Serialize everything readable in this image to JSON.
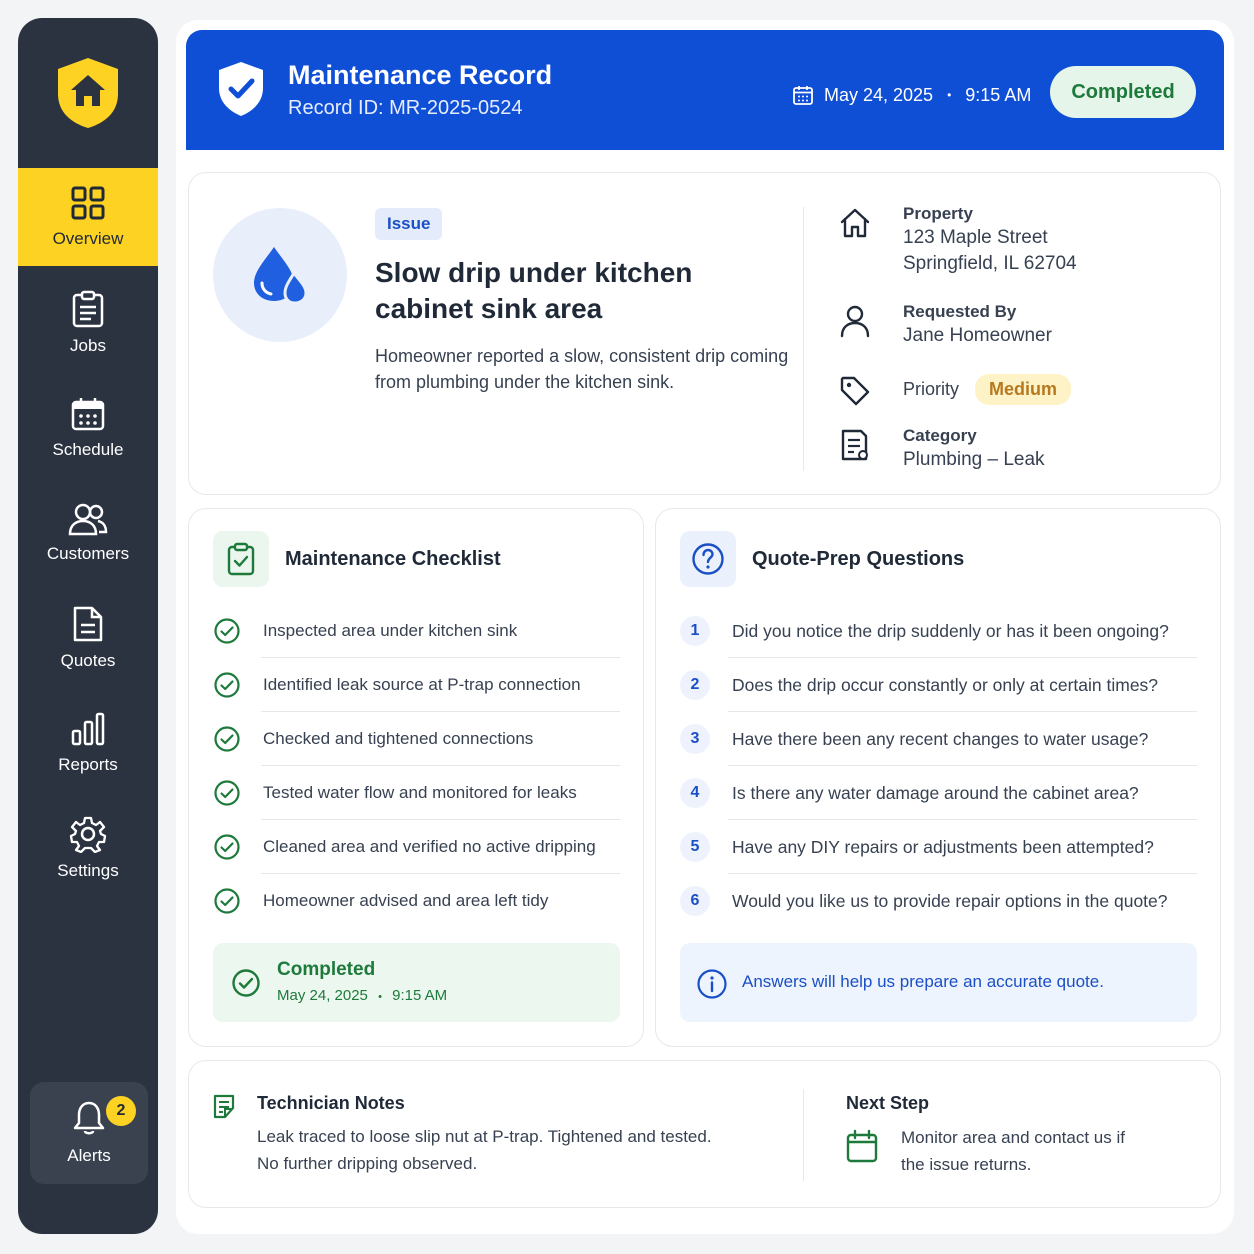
{
  "sidebar": {
    "items": [
      {
        "label": "Overview",
        "icon": "grid-icon",
        "active": true
      },
      {
        "label": "Jobs",
        "icon": "clipboard-icon"
      },
      {
        "label": "Schedule",
        "icon": "calendar-icon"
      },
      {
        "label": "Customers",
        "icon": "users-icon"
      },
      {
        "label": "Quotes",
        "icon": "document-icon"
      },
      {
        "label": "Reports",
        "icon": "bar-chart-icon"
      },
      {
        "label": "Settings",
        "icon": "gear-icon"
      }
    ],
    "alerts": {
      "label": "Alerts",
      "count": "2"
    }
  },
  "header": {
    "title": "Maintenance Record",
    "record_id": "Record ID: MR-2025-0524",
    "date": "May 24, 2025",
    "time": "9:15 AM",
    "status": "Completed"
  },
  "issue": {
    "tag": "Issue",
    "title": "Slow drip under kitchen cabinet sink area",
    "description": "Homeowner reported a slow, consistent drip coming from plumbing under the kitchen sink."
  },
  "details": {
    "property_label": "Property",
    "property_line1": "123 Maple Street",
    "property_line2": "Springfield, IL 62704",
    "requested_label": "Requested By",
    "requested_value": "Jane Homeowner",
    "priority_label": "Priority",
    "priority_value": "Medium",
    "category_label": "Category",
    "category_value": "Plumbing – Leak"
  },
  "checklist": {
    "title": "Maintenance Checklist",
    "items": [
      "Inspected area under kitchen sink",
      "Identified leak source at P-trap connection",
      "Checked and tightened connections",
      "Tested water flow and monitored for leaks",
      "Cleaned area and verified no active dripping",
      "Homeowner advised and area left tidy"
    ],
    "completed_label": "Completed",
    "completed_date": "May 24, 2025",
    "completed_time": "9:15 AM"
  },
  "questions": {
    "title": "Quote-Prep Questions",
    "items": [
      {
        "num": "1",
        "text": "Did you notice the drip suddenly or has it been ongoing?"
      },
      {
        "num": "2",
        "text": "Does the drip occur constantly or only at certain times?"
      },
      {
        "num": "3",
        "text": "Have there been any recent changes to water usage?"
      },
      {
        "num": "4",
        "text": "Is there any water damage around the cabinet area?"
      },
      {
        "num": "5",
        "text": "Have any DIY repairs or adjustments been attempted?"
      },
      {
        "num": "6",
        "text": "Would you like us to provide repair options in the quote?"
      }
    ],
    "info": "Answers will help us prepare an accurate quote."
  },
  "notes": {
    "title": "Technician Notes",
    "line1": "Leak traced to loose slip nut at P-trap. Tightened and tested.",
    "line2": "No further dripping observed."
  },
  "next_step": {
    "title": "Next Step",
    "line1": "Monitor area and contact us if",
    "line2": "the issue returns."
  },
  "colors": {
    "header_blue": "#0f4fd6",
    "sidebar_dark": "#2c3340",
    "accent_yellow": "#fdd222",
    "success_green": "#1e7a3b",
    "priority_amber": "#b7791f"
  }
}
